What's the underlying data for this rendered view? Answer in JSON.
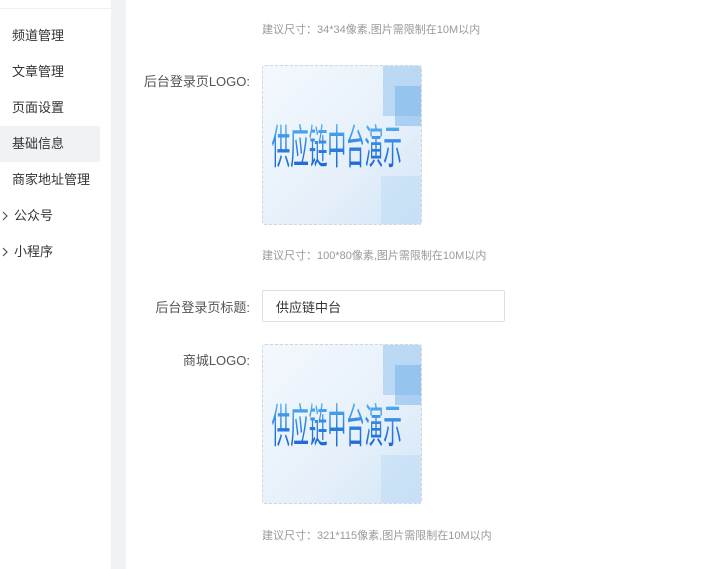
{
  "sidebar": {
    "items": [
      {
        "label": "频道管理"
      },
      {
        "label": "文章管理"
      },
      {
        "label": "页面设置"
      },
      {
        "label": "基础信息",
        "active": true
      },
      {
        "label": "商家地址管理"
      },
      {
        "label": "公众号",
        "expandable": true
      },
      {
        "label": "小程序",
        "expandable": true
      }
    ]
  },
  "form": {
    "favicon_hint": "建议尺寸：34*34像素,图片需限制在10M以内",
    "admin_logo": {
      "label": "后台登录页LOGO:",
      "image_text": "供应链中台演示",
      "hint": "建议尺寸：100*80像素,图片需限制在10M以内"
    },
    "admin_title": {
      "label": "后台登录页标题:",
      "value": "供应链中台"
    },
    "mall_logo": {
      "label": "商城LOGO:",
      "image_text": "供应链中台演示",
      "hint": "建议尺寸：321*115像素,图片需限制在10M以内"
    }
  },
  "colors": {
    "accent_text": "#2a7de1",
    "sidebar_active_bg": "#f0f2f5",
    "hint_text": "#999999"
  },
  "icons": {
    "group_toggle": "chevron-right-icon"
  }
}
